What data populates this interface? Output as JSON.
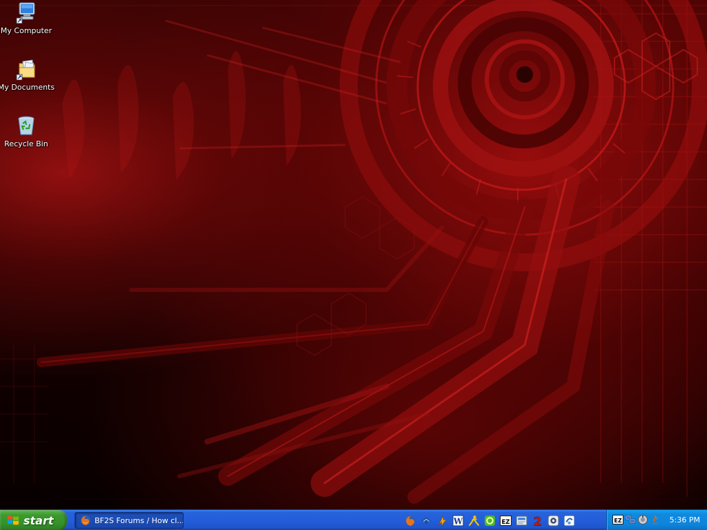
{
  "desktop": {
    "icons": [
      {
        "label": "My Computer",
        "icon": "my-computer-icon"
      },
      {
        "label": "My Documents",
        "icon": "my-documents-icon"
      },
      {
        "label": "Recycle Bin",
        "icon": "recycle-bin-icon"
      }
    ],
    "wallpaper_colors": {
      "primary": "#b01010",
      "dark": "#1a0101",
      "line": "#ff2a2a"
    }
  },
  "taskbar": {
    "start_label": "start",
    "task_button": {
      "label": "BF2S Forums / How cl...",
      "icon": "firefox-icon"
    },
    "quick_launch": [
      {
        "icon": "firefox-icon"
      },
      {
        "icon": "thunderbird-icon"
      },
      {
        "icon": "winamp-icon"
      },
      {
        "icon": "word-icon",
        "text": "W"
      },
      {
        "icon": "aim-icon"
      },
      {
        "icon": "green-app-icon"
      },
      {
        "icon": "ez-icon",
        "text": "EZ"
      },
      {
        "icon": "picture-icon"
      },
      {
        "icon": "battlefield2-icon",
        "text": "2"
      },
      {
        "icon": "gamespy-icon"
      },
      {
        "icon": "messenger-icon"
      }
    ],
    "tray": {
      "icons": [
        {
          "icon": "ez-tray-icon",
          "text": "EZ"
        },
        {
          "icon": "network-icon"
        },
        {
          "icon": "volume-icon"
        },
        {
          "icon": "java-icon"
        }
      ],
      "clock": "5:36 PM"
    },
    "colors": {
      "taskbar": "#245edb",
      "start": "#3c9a2f",
      "tray": "#0e84db"
    }
  }
}
